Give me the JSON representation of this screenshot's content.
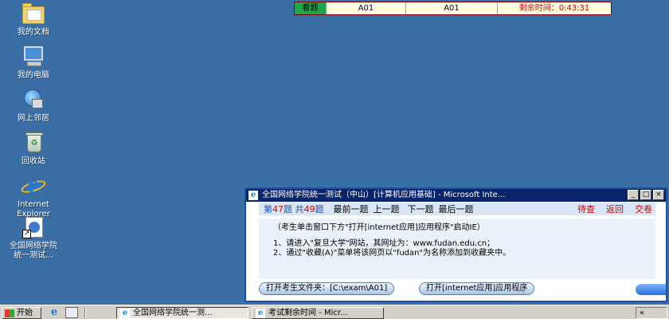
{
  "desktop": {
    "icons": [
      {
        "label": "我的文档",
        "icon": "my-documents-icon"
      },
      {
        "label": "我的电脑",
        "icon": "my-computer-icon"
      },
      {
        "label": "网上邻居",
        "icon": "network-places-icon"
      },
      {
        "label": "回收站",
        "icon": "recycle-bin-icon"
      },
      {
        "label_line1": "Internet",
        "label_line2": "Explorer",
        "icon": "internet-explorer-icon"
      },
      {
        "label_line1": "全国网络学院",
        "label_line2": "统一测试...",
        "icon": "shortcut-icon"
      }
    ]
  },
  "status_bar": {
    "tag": "看题",
    "cell1": "A01",
    "cell2": "A01",
    "remaining": "剩余时间：0:43:31"
  },
  "window": {
    "title": "全国网络学院统一测试（中山）[计算机应用基础] - Microsoft Inte...",
    "title_buttons": {
      "minimize": "_",
      "maximize": "□",
      "close": "×"
    },
    "nav": {
      "count_prefix": "第",
      "current": "47",
      "count_mid": "题  共",
      "total": "49",
      "count_suffix": "题",
      "first": "最前一题",
      "prev": "上一题",
      "next": "下一题",
      "last": "最后一题",
      "check": "待查",
      "back": "返回",
      "submit": "交卷"
    },
    "content": {
      "line1": "（考生单击窗口下方\"打开[internet应用]应用程序\"启动IE）",
      "line2": "1、请进入\"复旦大学\"网站，其网址为：www.fudan.edu.cn；",
      "line3": "2、通过\"收藏(A)\"菜单将该网页以\"fudan\"为名称添加到收藏夹中。"
    },
    "buttons": {
      "open_folder": "打开考生文件夹：[C:\\exam\\A01]",
      "open_ie": "打开[internet应用]应用程序"
    }
  },
  "taskbar": {
    "start": "开始",
    "tasks": [
      "全国网络学院统一测...",
      "考试剩余时间 - Micr..."
    ],
    "tray": "«"
  },
  "colors": {
    "desktop_bg": "#3a6ea5",
    "title_bg": "#0a246a",
    "status_tag_bg": "#1ea64a",
    "warning_red": "#d00000"
  }
}
